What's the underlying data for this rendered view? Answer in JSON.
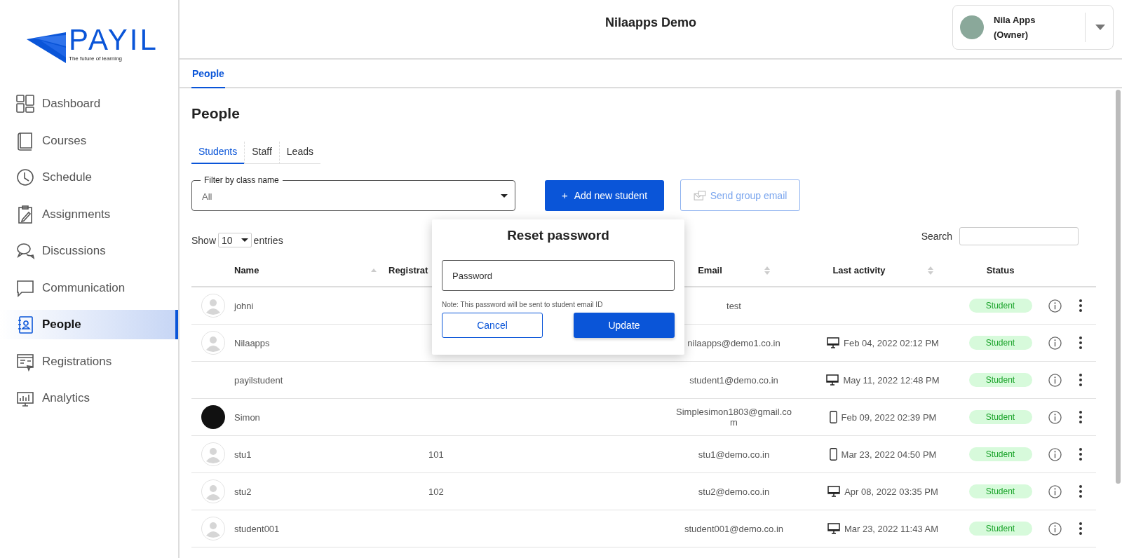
{
  "brand": {
    "name": "PAYIL",
    "tagline": "The future of learning"
  },
  "sidebar": {
    "items": [
      {
        "label": "Dashboard",
        "kind": "dashboard",
        "selected": false
      },
      {
        "label": "Courses",
        "kind": "book",
        "selected": false
      },
      {
        "label": "Schedule",
        "kind": "clock",
        "selected": false
      },
      {
        "label": "Assignments",
        "kind": "clipboard",
        "selected": false
      },
      {
        "label": "Discussions",
        "kind": "chats",
        "selected": false
      },
      {
        "label": "Communication",
        "kind": "chat",
        "selected": false
      },
      {
        "label": "People",
        "kind": "contacts",
        "selected": true
      },
      {
        "label": "Registrations",
        "kind": "form",
        "selected": false
      },
      {
        "label": "Analytics",
        "kind": "analytics",
        "selected": false
      }
    ]
  },
  "header": {
    "title": "Nilaapps Demo",
    "user": {
      "name": "Nila Apps",
      "role": "(Owner)"
    }
  },
  "top_tabs": [
    {
      "label": "People",
      "selected": true
    }
  ],
  "page_title": "People",
  "sub_tabs": [
    {
      "label": "Students",
      "selected": true
    },
    {
      "label": "Staff",
      "selected": false
    },
    {
      "label": "Leads",
      "selected": false
    }
  ],
  "filter": {
    "label": "Filter by class name",
    "value": "All"
  },
  "add_button": {
    "icon": "+",
    "label": "Add new student"
  },
  "email_button": {
    "label": "Send group email",
    "disabled": true
  },
  "entries": {
    "before": "Show",
    "value": "10",
    "after": "entries"
  },
  "search": {
    "label": "Search"
  },
  "table": {
    "columns": [
      {
        "label": "Name",
        "sort": {
          "kind": "asc"
        }
      },
      {
        "label": "Registrat"
      },
      {
        "label": "Email",
        "sort": {
          "kind": "both"
        }
      },
      {
        "label": "Last activity",
        "sort": {
          "kind": "both"
        }
      },
      {
        "label": "Status"
      }
    ],
    "rows": [
      {
        "avatar": {
          "kind": "default"
        },
        "name": "johni",
        "email": "test",
        "status": "Student"
      },
      {
        "avatar": {
          "kind": "default"
        },
        "name": "Nilaapps",
        "email": "nilaapps@demo1.co.in",
        "device": {
          "kind": "desktop"
        },
        "last_activity": "Feb 04, 2022 02:12 PM",
        "status": "Student"
      },
      {
        "name": "payilstudent",
        "email": "student1@demo.co.in",
        "device": {
          "kind": "desktop"
        },
        "last_activity": "May 11, 2022 12:48 PM",
        "status": "Student"
      },
      {
        "avatar": {
          "kind": "photo"
        },
        "name": "Simon",
        "email": "Simplesimon1803@gmail.com",
        "device": {
          "kind": "mobile"
        },
        "last_activity": "Feb 09, 2022 02:39 PM",
        "status": "Student"
      },
      {
        "avatar": {
          "kind": "default"
        },
        "name": "stu1",
        "registration": "101",
        "email": "stu1@demo.co.in",
        "device": {
          "kind": "mobile"
        },
        "last_activity": "Mar 23, 2022 04:50 PM",
        "status": "Student"
      },
      {
        "avatar": {
          "kind": "default"
        },
        "name": "stu2",
        "registration": "102",
        "email": "stu2@demo.co.in",
        "device": {
          "kind": "desktop"
        },
        "last_activity": "Apr 08, 2022 03:35 PM",
        "status": "Student"
      },
      {
        "avatar": {
          "kind": "default"
        },
        "name": "student001",
        "email": "student001@demo.co.in",
        "device": {
          "kind": "desktop"
        },
        "last_activity": "Mar 23, 2022 11:43 AM",
        "status": "Student"
      }
    ]
  },
  "modal": {
    "title": "Reset password",
    "placeholder": "Password",
    "note_label": "Note:",
    "note": "This password will be sent to student email ID",
    "cancel": "Cancel",
    "submit": "Update"
  }
}
